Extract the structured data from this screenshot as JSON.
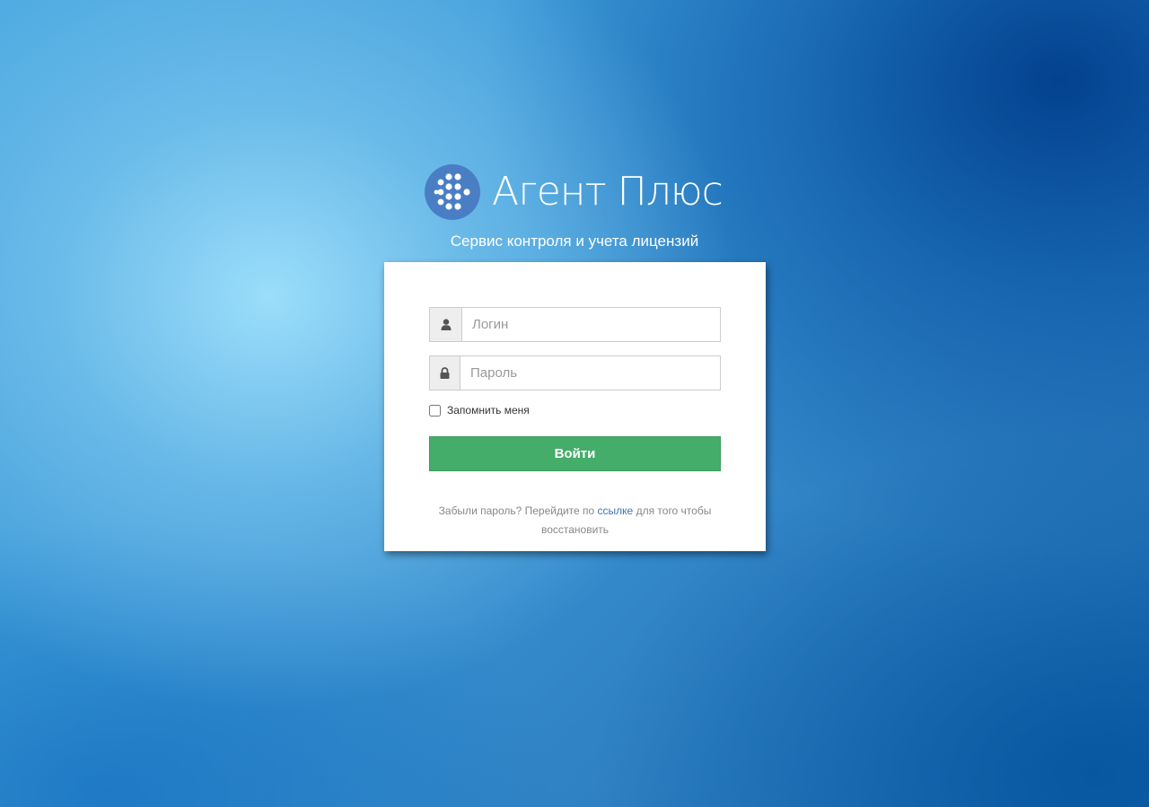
{
  "brand": {
    "name": "Агент Плюс",
    "logo_color": "#4a7ec4"
  },
  "subtitle": "Сервис контроля и учета лицензий",
  "form": {
    "login": {
      "icon": "user-icon",
      "placeholder": "Логин",
      "value": ""
    },
    "password": {
      "icon": "lock-icon",
      "placeholder": "Пароль",
      "value": ""
    },
    "remember_me": {
      "label": "Запомнить меня",
      "checked": false
    },
    "submit": {
      "label": "Войти",
      "color": "#45ad6a"
    },
    "help": {
      "text_before": "Забыли пароль? Перейдите по ",
      "link_label": "ссылке",
      "text_after": " для того чтобы восстановить",
      "link_color": "#3c74b8"
    }
  }
}
